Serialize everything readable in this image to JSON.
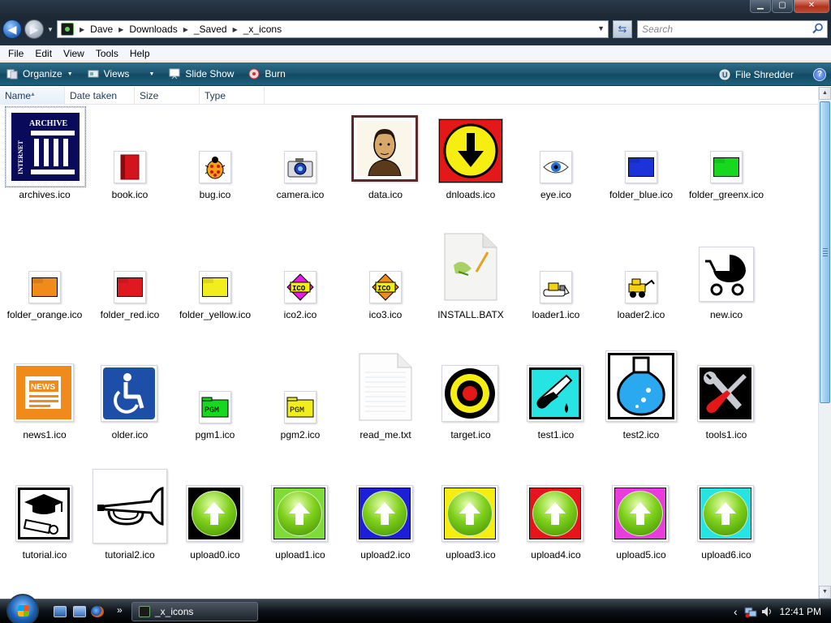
{
  "window": {
    "controls": [
      "minimize",
      "maximize",
      "close"
    ]
  },
  "address": {
    "crumbs": [
      "Dave",
      "Downloads",
      "_Saved",
      "_x_icons"
    ],
    "search_placeholder": "Search"
  },
  "menu": [
    "File",
    "Edit",
    "View",
    "Tools",
    "Help"
  ],
  "commands": {
    "organize": "Organize",
    "views": "Views",
    "slideshow": "Slide Show",
    "burn": "Burn",
    "shredder": "File Shredder",
    "help_glyph": "?"
  },
  "columns": [
    "Name",
    "Date taken",
    "Size",
    "Type"
  ],
  "files": [
    {
      "name": "archives.ico",
      "icon": "internet-archive-icon",
      "selected": true
    },
    {
      "name": "book.ico",
      "icon": "red-book-icon"
    },
    {
      "name": "bug.ico",
      "icon": "ladybug-icon"
    },
    {
      "name": "camera.ico",
      "icon": "camera-icon"
    },
    {
      "name": "data.ico",
      "icon": "portrait-icon"
    },
    {
      "name": "dnloads.ico",
      "icon": "download-arrow-icon"
    },
    {
      "name": "eye.ico",
      "icon": "eye-icon"
    },
    {
      "name": "folder_blue.ico",
      "icon": "folder-icon",
      "color": "#1b33d8"
    },
    {
      "name": "folder_greenx.ico",
      "icon": "folder-icon",
      "color": "#17d81f"
    },
    {
      "name": "folder_orange.ico",
      "icon": "folder-icon",
      "color": "#f08a1a"
    },
    {
      "name": "folder_red.ico",
      "icon": "folder-icon",
      "color": "#e0181f"
    },
    {
      "name": "folder_yellow.ico",
      "icon": "folder-icon",
      "color": "#f2ee1e"
    },
    {
      "name": "ico2.ico",
      "icon": "ico-badge-magenta-icon",
      "badge": "ICO"
    },
    {
      "name": "ico3.ico",
      "icon": "ico-badge-orange-icon",
      "badge": "ICO"
    },
    {
      "name": "INSTALL.BATX",
      "icon": "script-document-icon"
    },
    {
      "name": "loader1.ico",
      "icon": "bulldozer-icon"
    },
    {
      "name": "loader2.ico",
      "icon": "loader-vehicle-icon"
    },
    {
      "name": "new.ico",
      "icon": "baby-stroller-icon"
    },
    {
      "name": "news1.ico",
      "icon": "newspaper-icon",
      "badge": "NEWS"
    },
    {
      "name": "older.ico",
      "icon": "wheelchair-icon"
    },
    {
      "name": "pgm1.ico",
      "icon": "pgm-green-icon",
      "badge": "PGM"
    },
    {
      "name": "pgm2.ico",
      "icon": "pgm-yellow-icon",
      "badge": "PGM"
    },
    {
      "name": "read_me.txt",
      "icon": "text-document-icon"
    },
    {
      "name": "target.ico",
      "icon": "target-icon"
    },
    {
      "name": "test1.ico",
      "icon": "test-tube-icon"
    },
    {
      "name": "test2.ico",
      "icon": "flask-icon"
    },
    {
      "name": "tools1.ico",
      "icon": "wrench-screwdriver-icon"
    },
    {
      "name": "tutorial.ico",
      "icon": "graduation-cap-icon"
    },
    {
      "name": "tutorial2.ico",
      "icon": "bugle-icon"
    },
    {
      "name": "upload0.ico",
      "icon": "upload-arrow-icon",
      "color": "#000000"
    },
    {
      "name": "upload1.ico",
      "icon": "upload-arrow-icon",
      "color": "#7ddc3a"
    },
    {
      "name": "upload2.ico",
      "icon": "upload-arrow-icon",
      "color": "#1d1fd8"
    },
    {
      "name": "upload3.ico",
      "icon": "upload-arrow-icon",
      "color": "#f6ee10"
    },
    {
      "name": "upload4.ico",
      "icon": "upload-arrow-icon",
      "color": "#e8141c"
    },
    {
      "name": "upload5.ico",
      "icon": "upload-arrow-icon",
      "color": "#e83cdc"
    },
    {
      "name": "upload6.ico",
      "icon": "upload-arrow-icon",
      "color": "#27e4e4"
    }
  ],
  "taskbar": {
    "window_title": "_x_icons",
    "clock": "12:41 PM",
    "show_more": "»",
    "tray_chevron": "‹"
  }
}
